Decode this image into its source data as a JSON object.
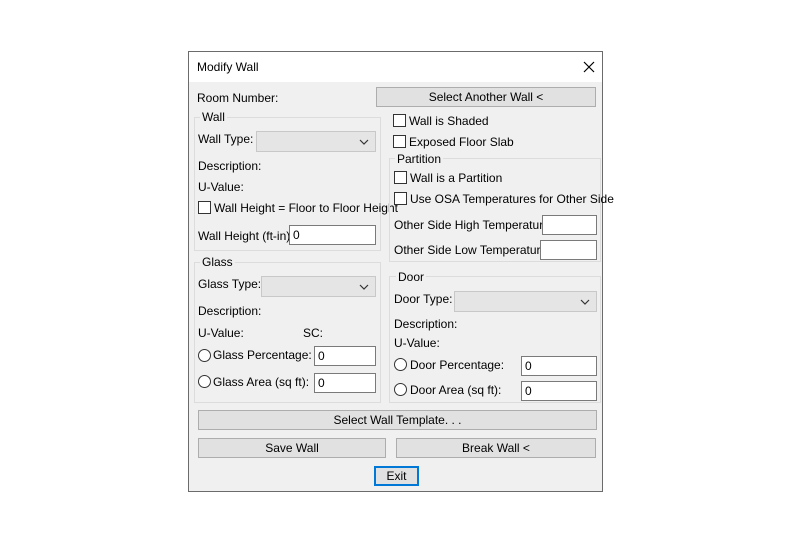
{
  "window": {
    "title": "Modify Wall",
    "close_icon": "close-icon"
  },
  "room_number_label": "Room Number:",
  "select_another_wall_label": "Select Another Wall <",
  "wall_group": {
    "legend": "Wall",
    "type_label": "Wall Type:",
    "description_label": "Description:",
    "uvalue_label": "U-Value:",
    "height_checkbox_label": "Wall Height = Floor to Floor Height",
    "height_label": "Wall Height (ft-in):",
    "height_value": "0"
  },
  "checkboxes": {
    "shaded": "Wall is Shaded",
    "exposed_floor": "Exposed Floor Slab"
  },
  "partition_group": {
    "legend": "Partition",
    "is_partition": "Wall is a Partition",
    "use_osa": "Use OSA Temperatures for Other Side",
    "high_temp_label": "Other Side High Temperature:",
    "low_temp_label": "Other Side Low Temperature:",
    "high_temp_value": "",
    "low_temp_value": ""
  },
  "glass_group": {
    "legend": "Glass",
    "type_label": "Glass Type:",
    "description_label": "Description:",
    "uvalue_label": "U-Value:",
    "sc_label": "SC:",
    "percentage_label": "Glass Percentage:",
    "percentage_value": "0",
    "area_label": "Glass Area (sq ft):",
    "area_value": "0"
  },
  "door_group": {
    "legend": "Door",
    "type_label": "Door Type:",
    "description_label": "Description:",
    "uvalue_label": "U-Value:",
    "percentage_label": "Door Percentage:",
    "percentage_value": "0",
    "area_label": "Door Area (sq ft):",
    "area_value": "0"
  },
  "buttons": {
    "select_template": "Select Wall Template. . .",
    "save_wall": "Save Wall",
    "break_wall": "Break Wall <",
    "exit": "Exit"
  }
}
